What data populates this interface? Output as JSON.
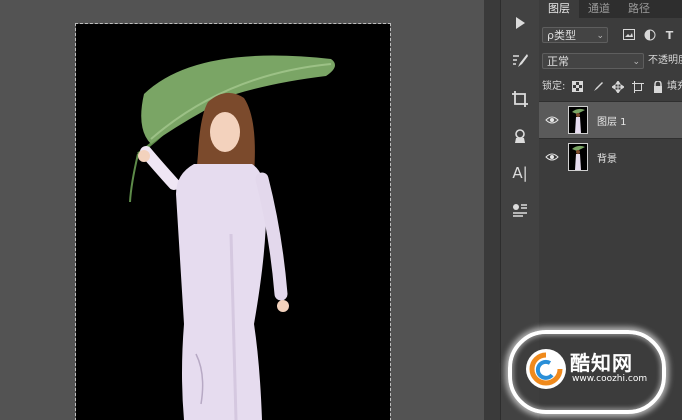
{
  "layers_panel": {
    "tabs": [
      {
        "label": "图层",
        "active": true
      },
      {
        "label": "通道",
        "active": false
      },
      {
        "label": "路径",
        "active": false
      }
    ],
    "filter_type": "ρ类型",
    "blend_mode": "正常",
    "opacity_label": "不透明度",
    "lock_label": "锁定:",
    "fill_label": "填充",
    "filter_icon_t": "T",
    "layers": [
      {
        "name": "图层 1",
        "selected": true,
        "visible": true
      },
      {
        "name": "背景",
        "selected": false,
        "visible": true
      }
    ]
  },
  "toolbar": {
    "tools": [
      "play-icon",
      "brush-settings-icon",
      "crop-icon",
      "clone-stamp-icon",
      "character-icon",
      "paragraph-icon"
    ],
    "character_glyph": "A|"
  },
  "watermark": {
    "title": "酷知网",
    "url": "www.coozhi.com"
  },
  "colors": {
    "canvas_bg": "#535353",
    "document_bg": "#000000",
    "panel_bg": "#3c3c3c",
    "selected_layer": "#5a5a5a",
    "dress": "#e6dcef",
    "leaf": "#6f9a5e"
  }
}
